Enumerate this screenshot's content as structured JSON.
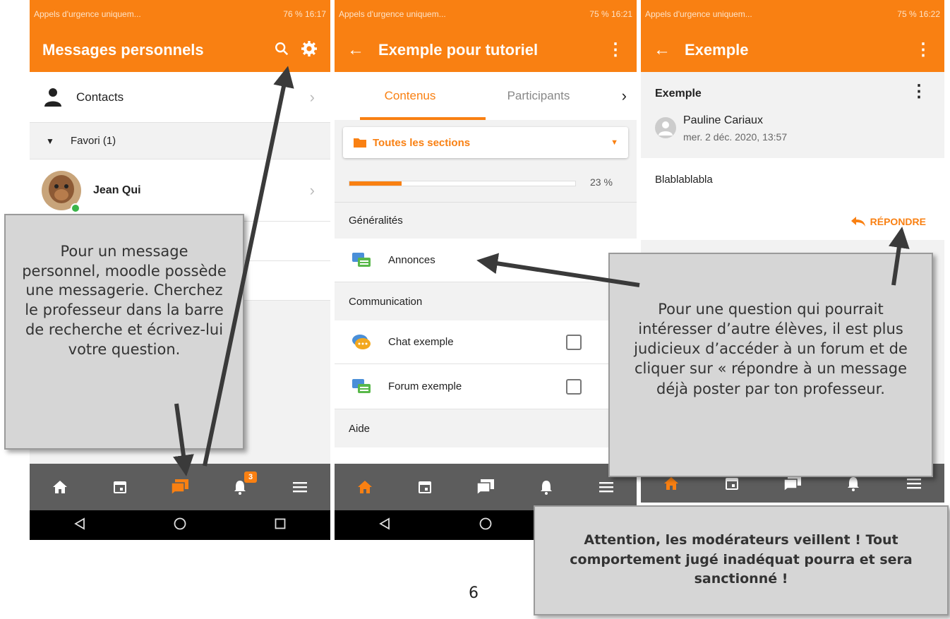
{
  "status": {
    "left": "Appels d'urgence uniquem...",
    "right_p1": "76 %  16:17",
    "right_p2": "75 %  16:21",
    "right_p3": "75 %  16:22"
  },
  "phone1": {
    "title": "Messages personnels",
    "contacts_label": "Contacts",
    "favori_label": "Favori (1)",
    "contact_name": "Jean Qui",
    "notification_count": "3"
  },
  "phone2": {
    "title": "Exemple pour tutoriel",
    "tabs": [
      "Contenus",
      "Participants"
    ],
    "section_select": "Toutes les sections",
    "progress_label": "23 %",
    "progress_value": 23,
    "sections": [
      "Généralités",
      "Communication",
      "Aide"
    ],
    "modules": [
      "Annonces",
      "Chat exemple",
      "Forum exemple"
    ]
  },
  "phone3": {
    "title": "Exemple",
    "post_subject": "Exemple",
    "author": "Pauline Cariaux",
    "date": "mer. 2 déc. 2020, 13:57",
    "message": "Blablablabla",
    "reply_label": "RÉPONDRE"
  },
  "callouts": {
    "left": "Pour un message personnel, moodle possède une messagerie. Cherchez le professeur dans la barre de recherche et écrivez-lui votre question.",
    "right": "Pour une question qui pourrait intéresser d’autre élèves, il est plus judicieux d’accéder à un forum et de cliquer sur « répondre à un message déjà poster par ton professeur.",
    "warning": "Attention, les modérateurs veillent ! Tout comportement jugé inadéquat pourra et sera sanctionné !"
  },
  "page_number": "6",
  "colors": {
    "accent": "#f98012",
    "navbar": "#5d5d5d",
    "callout": "#d6d6d6"
  }
}
